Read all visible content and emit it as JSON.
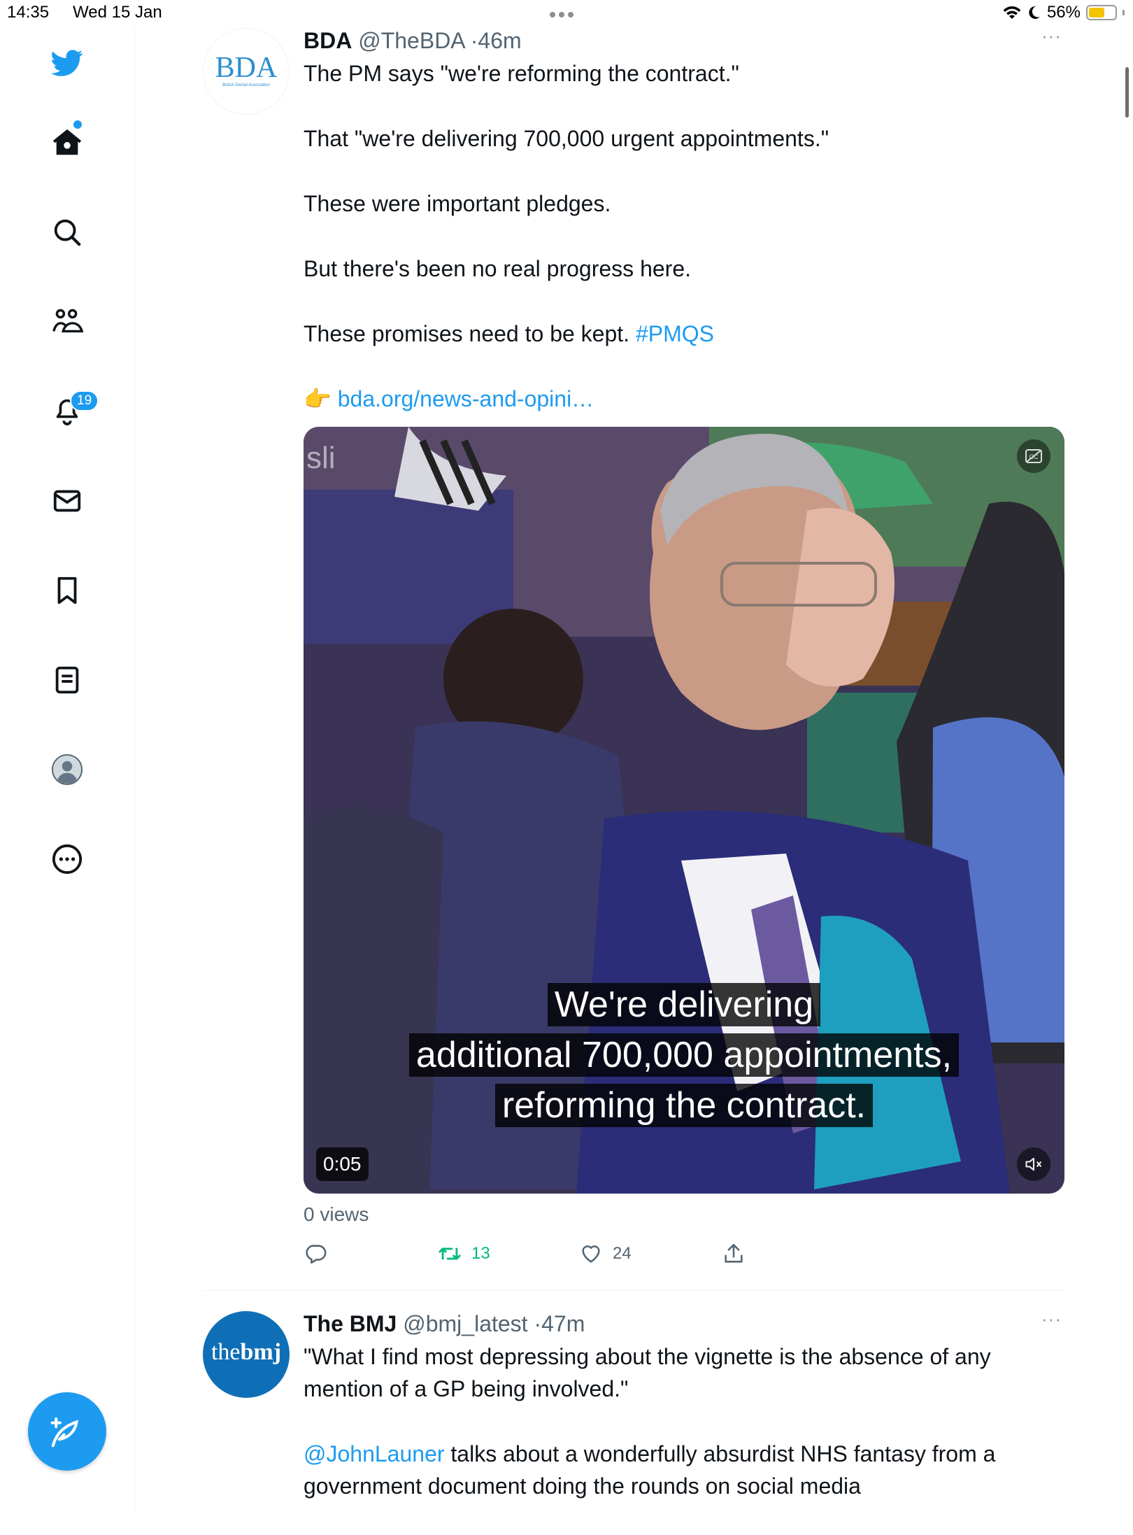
{
  "status_bar": {
    "time": "14:35",
    "date": "Wed 15 Jan",
    "battery": "56%",
    "battery_level": 0.56
  },
  "sidebar": {
    "items": [
      {
        "icon": "twitter-bird-icon"
      },
      {
        "icon": "home-icon"
      },
      {
        "icon": "search-icon"
      },
      {
        "icon": "communities-icon"
      },
      {
        "icon": "notifications-icon",
        "badge": "19"
      },
      {
        "icon": "messages-icon"
      },
      {
        "icon": "bookmarks-icon"
      },
      {
        "icon": "lists-icon"
      },
      {
        "icon": "profile-icon"
      },
      {
        "icon": "more-icon"
      }
    ],
    "compose_icon": "compose-tweet-icon"
  },
  "tweets": [
    {
      "avatar_text": "BDA",
      "avatar_subtext": "British Dental Association",
      "name": "BDA",
      "handle": "@TheBDA",
      "time": "46m",
      "more": "···",
      "paragraphs": [
        "The PM says \"we're reforming the contract.\"",
        "That \"we're delivering 700,000 urgent appointments.\"",
        "These were important pledges.",
        "But there's been no real progress here.",
        "These promises need to be kept."
      ],
      "hashtag": "#PMQS",
      "link_emoji": "👉",
      "link": "bda.org/news-and-opini…",
      "video": {
        "caption_lines": [
          "We're delivering",
          "additional 700,000 appointments,",
          "reforming the contract."
        ],
        "corner_text": "sli",
        "timer": "0:05"
      },
      "views": "0 views",
      "retweets": "13",
      "likes": "24",
      "colors": {
        "retweet": "#00ba7c",
        "link": "#1d9bf0"
      }
    },
    {
      "avatar_text_a": "the",
      "avatar_text_b": "bmj",
      "name": "The BMJ",
      "handle": "@bmj_latest",
      "time": "47m",
      "more": "···",
      "quote": "\"What I find most depressing about the vignette is the absence of any mention of a GP being involved.\"",
      "mention": "@JohnLauner",
      "text_after_mention": " talks about a wonderfully absurdist NHS fantasy from a government document doing the rounds on social media"
    }
  ]
}
